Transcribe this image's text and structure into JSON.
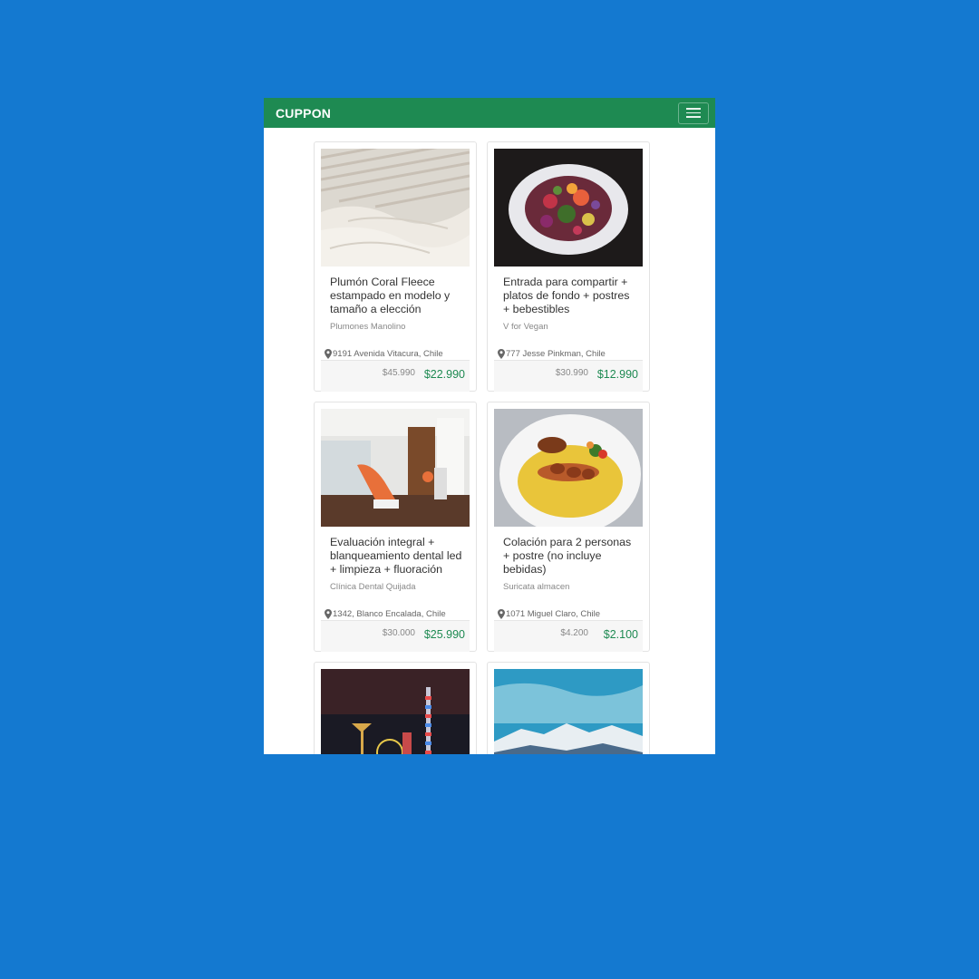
{
  "app": {
    "brand": "CUPPON"
  },
  "colors": {
    "background": "#1479d0",
    "navbar": "#1e8a52",
    "price": "#1e8a52"
  },
  "icons": {
    "menu": "hamburger-icon",
    "location": "map-pin-icon"
  },
  "cards": [
    {
      "image": "white bedding with window-blind shadows",
      "title": "Plumón Coral Fleece estampado en modelo y tamaño a elección",
      "merchant": "Plumones Manolino",
      "address": "9191 Avenida Vitacura, Chile",
      "old_price": "$45.990",
      "new_price": "$22.990"
    },
    {
      "image": "plate of colorful vegan salad",
      "title": "Entrada para compartir + platos de fondo + postres + bebestibles",
      "merchant": "V for Vegan",
      "address": "777 Jesse Pinkman, Chile",
      "old_price": "$30.990",
      "new_price": "$12.990"
    },
    {
      "image": "dental clinic chair",
      "title": "Evaluación integral + blanqueamiento dental led + limpieza + fluoración",
      "merchant": "Clínica Dental Quijada",
      "address": "1342, Blanco Encalada, Chile",
      "old_price": "$30.000",
      "new_price": "$25.990"
    },
    {
      "image": "skewers on yellow rice",
      "title": "Colación para 2 personas + postre (no incluye bebidas)",
      "merchant": "Suricata almacen",
      "address": "1071 Miguel Claro, Chile",
      "old_price": "$4.200",
      "new_price": "$2.100"
    },
    {
      "image": "amusement park at night"
    },
    {
      "image": "snowy mountains under blue sky"
    }
  ]
}
